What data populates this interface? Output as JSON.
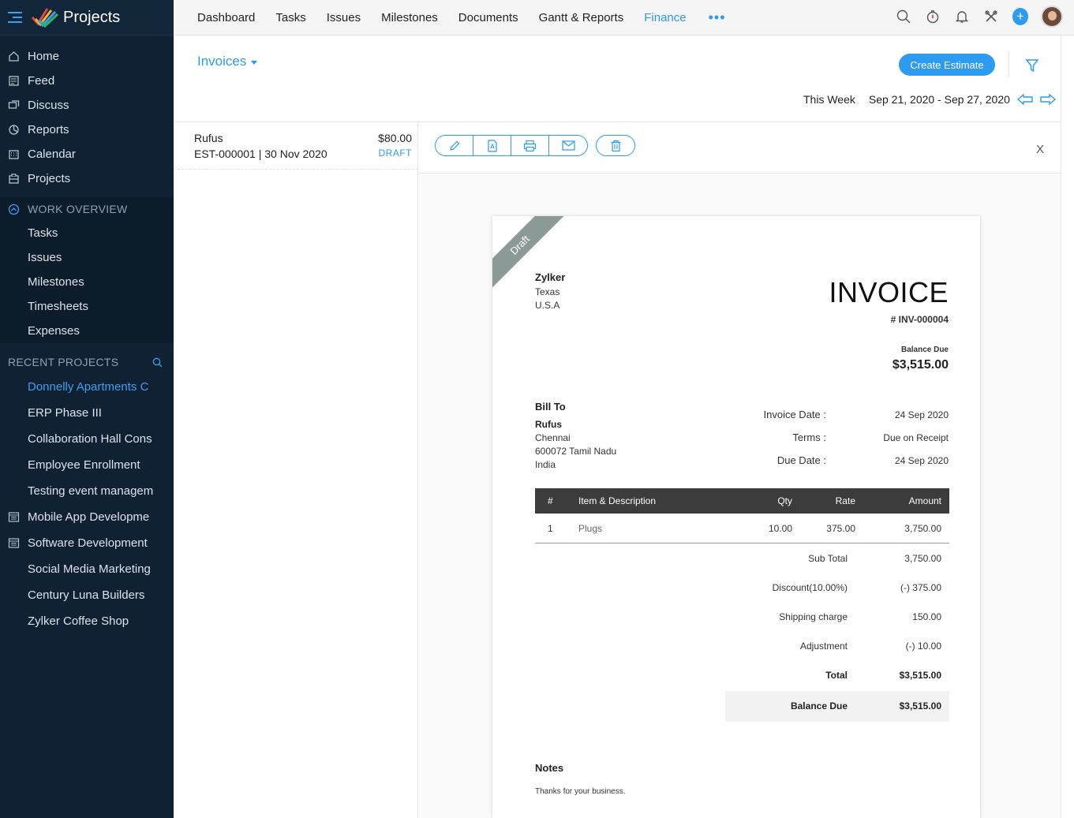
{
  "app": {
    "title": "Projects"
  },
  "sidebar": {
    "items": [
      {
        "label": "Home",
        "icon": "home-icon"
      },
      {
        "label": "Feed",
        "icon": "feed-icon"
      },
      {
        "label": "Discuss",
        "icon": "discuss-icon"
      },
      {
        "label": "Reports",
        "icon": "reports-icon"
      },
      {
        "label": "Calendar",
        "icon": "calendar-icon"
      },
      {
        "label": "Projects",
        "icon": "projects-icon"
      }
    ],
    "work_overview": {
      "title": "WORK OVERVIEW",
      "items": [
        "Tasks",
        "Issues",
        "Milestones",
        "Timesheets",
        "Expenses"
      ]
    },
    "recent": {
      "title": "RECENT PROJECTS",
      "projects": [
        {
          "label": "Donnelly Apartments C",
          "active": true,
          "icon": ""
        },
        {
          "label": "ERP Phase III",
          "icon": ""
        },
        {
          "label": "Collaboration Hall Cons",
          "icon": ""
        },
        {
          "label": "Employee Enrollment",
          "icon": ""
        },
        {
          "label": "Testing event managem",
          "icon": ""
        },
        {
          "label": "Mobile App Developme",
          "icon": "board-icon"
        },
        {
          "label": "Software Development",
          "icon": "board-icon"
        },
        {
          "label": "Social Media Marketing",
          "icon": ""
        },
        {
          "label": "Century Luna Builders",
          "icon": ""
        },
        {
          "label": "Zylker Coffee Shop",
          "icon": ""
        }
      ]
    }
  },
  "topnav": {
    "tabs": [
      "Dashboard",
      "Tasks",
      "Issues",
      "Milestones",
      "Documents",
      "Gantt & Reports",
      "Finance"
    ],
    "active": "Finance",
    "more": "•••"
  },
  "header": {
    "title": "Invoices",
    "create_label": "Create Estimate",
    "period": "This Week",
    "range": "Sep 21, 2020 - Sep 27, 2020"
  },
  "list": {
    "rows": [
      {
        "customer": "Rufus",
        "number": "EST-000001",
        "sep": " | ",
        "date": "30 Nov 2020",
        "amount": "$80.00",
        "status": "DRAFT"
      }
    ]
  },
  "toolbar": {
    "close": "X"
  },
  "invoice": {
    "ribbon": "Draft",
    "org": {
      "name": "Zylker",
      "line1": "Texas",
      "line2": "U.S.A"
    },
    "title": "INVOICE",
    "number": "# INV-000004",
    "balance_due_label": "Balance Due",
    "balance_due": "$3,515.00",
    "bill_to_label": "Bill To",
    "bill_to": {
      "name": "Rufus",
      "lines": [
        "Chennai",
        "600072 Tamil Nadu",
        "India"
      ]
    },
    "meta": [
      {
        "label": "Invoice Date :",
        "value": "24 Sep 2020"
      },
      {
        "label": "Terms :",
        "value": "Due on Receipt"
      },
      {
        "label": "Due Date :",
        "value": "24 Sep 2020"
      }
    ],
    "columns": {
      "hash": "#",
      "desc": "Item & Description",
      "qty": "Qty",
      "rate": "Rate",
      "amount": "Amount"
    },
    "items": [
      {
        "n": "1",
        "desc": "Plugs",
        "qty": "10.00",
        "rate": "375.00",
        "amount": "3,750.00"
      }
    ],
    "totals": [
      {
        "label": "Sub Total",
        "value": "3,750.00"
      },
      {
        "label": "Discount(10.00%)",
        "value": "(-) 375.00"
      },
      {
        "label": "Shipping charge",
        "value": "150.00"
      },
      {
        "label": "Adjustment",
        "value": "(-) 10.00"
      },
      {
        "label": "Total",
        "value": "$3,515.00"
      },
      {
        "label": "Balance Due",
        "value": "$3,515.00"
      }
    ],
    "notes_label": "Notes",
    "notes": "Thanks for your business."
  },
  "colors": {
    "accent": "#2d9bf0",
    "sidebar": "#0f2132",
    "table_head": "#3c3c3c",
    "ribbon": "#8c9a97"
  }
}
